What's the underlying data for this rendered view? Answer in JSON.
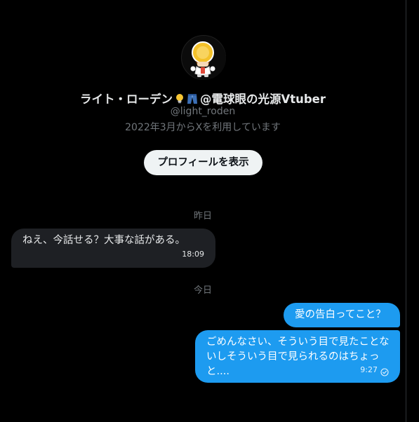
{
  "profile": {
    "display_name": "ライト・ローデン",
    "display_name_suffix": "@電球眼の光源Vtuber",
    "handle": "@light_roden",
    "joined": "2022年3月からXを利用しています",
    "view_profile_label": "プロフィールを表示",
    "emoji": [
      "lightbulb-icon",
      "jeans-icon"
    ]
  },
  "conversation": {
    "separators": {
      "yesterday": "昨日",
      "today": "今日"
    },
    "messages": [
      {
        "direction": "incoming",
        "text": "ねえ、今話せる？大事な話がある。",
        "time": "18:09"
      },
      {
        "direction": "outgoing",
        "text": "愛の告白ってこと？",
        "time": ""
      },
      {
        "direction": "outgoing",
        "text": "ごめんなさい、そういう目で見たことないしそういう目で見られるのはちょっと....",
        "time": "9:27",
        "status_icon": "read-check-icon"
      }
    ]
  },
  "colors": {
    "background": "#000000",
    "incoming_bubble": "#1e2024",
    "outgoing_bubble": "#1d9bf0",
    "secondary_text": "#71767b",
    "primary_text": "#e7e9ea"
  }
}
